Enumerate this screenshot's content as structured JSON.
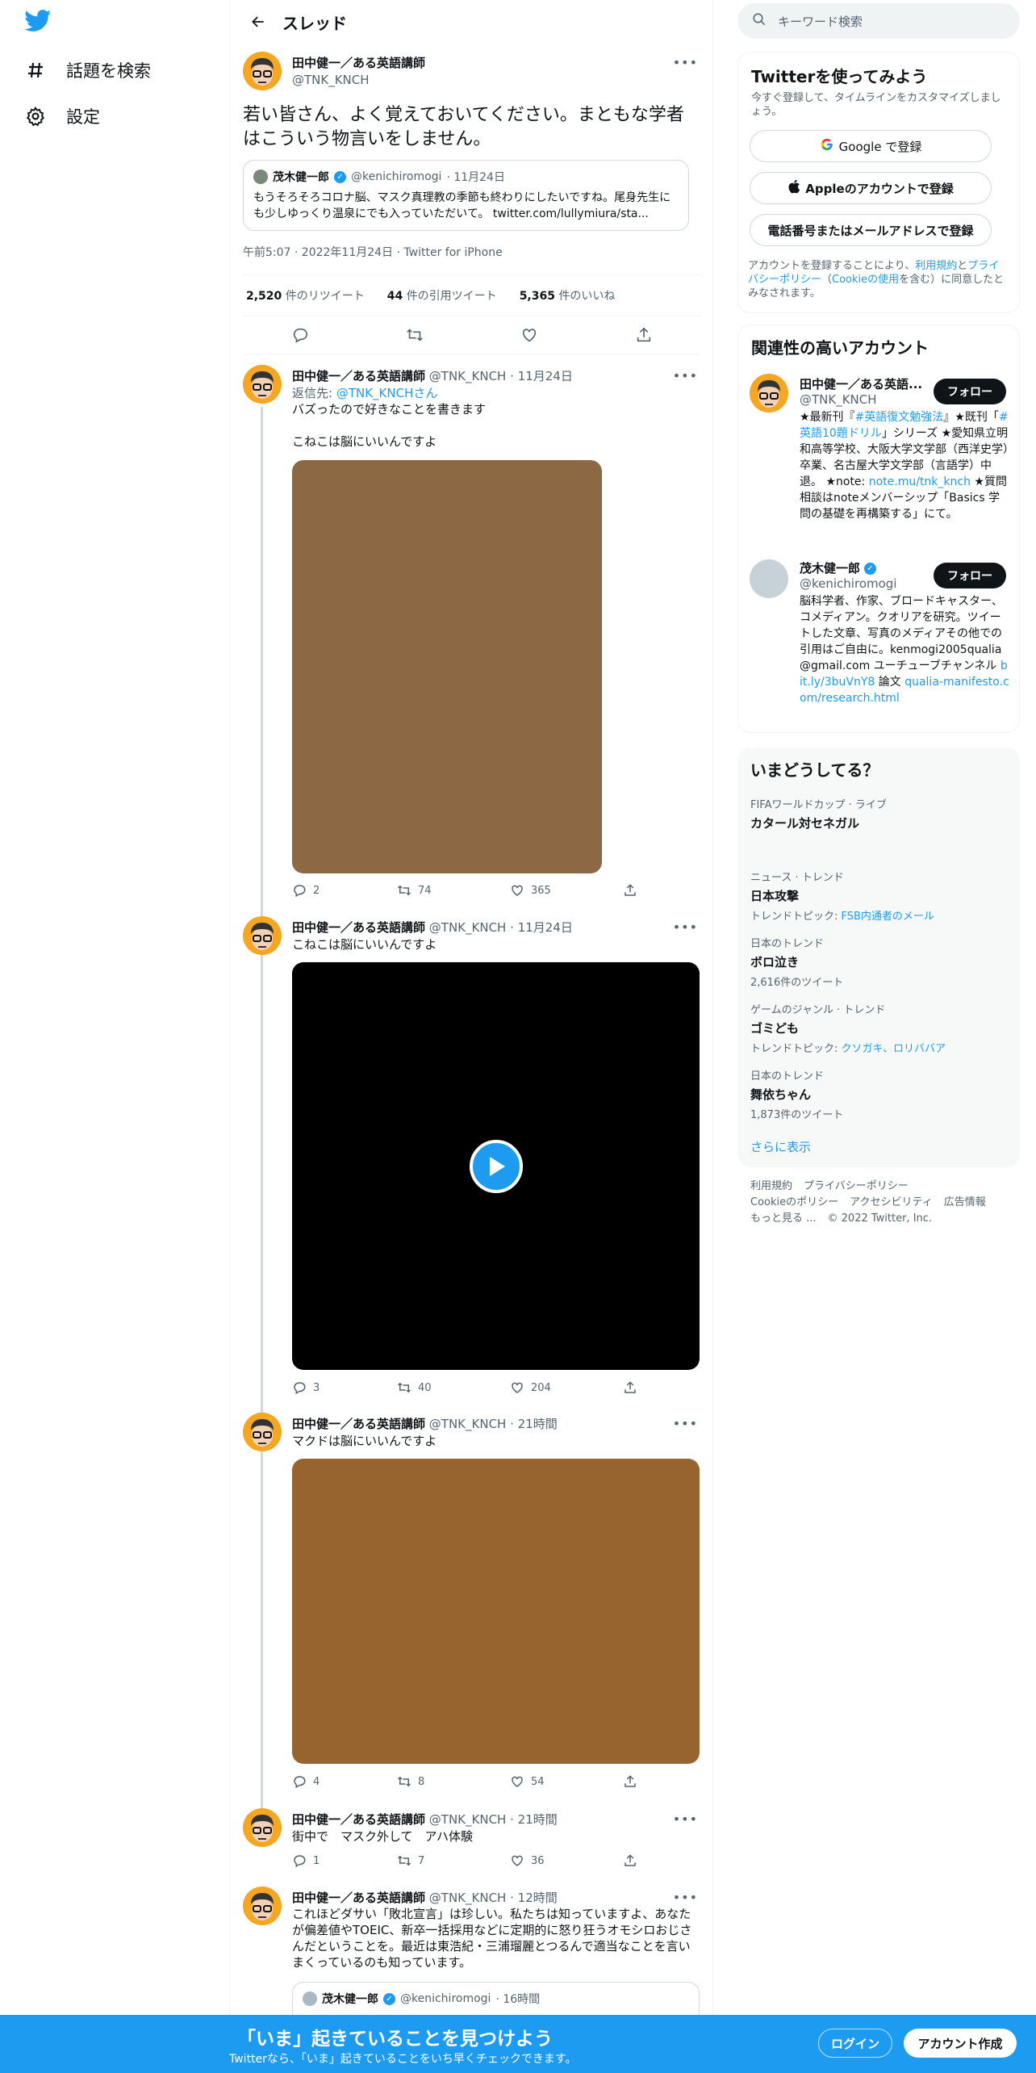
{
  "nav": {
    "explore": "話題を検索",
    "settings": "設定"
  },
  "header": {
    "title": "スレッド"
  },
  "main_tweet": {
    "name": "田中健一／ある英語講師",
    "handle": "@TNK_KNCH",
    "text": "若い皆さん、よく覚えておいてください。まともな学者はこういう物言いをしません。",
    "quote": {
      "name": "茂木健一郎",
      "handle": "@kenichiromogi",
      "date": "· 11月24日",
      "text": "もうそろそろコロナ脳、マスク真理教の季節も終わりにしたいですね。尾身先生にも少しゆっくり温泉にでも入っていただいて。 twitter.com/lullymiura/sta..."
    },
    "meta": "午前5:07 · 2022年11月24日 · Twitter for iPhone",
    "retweets": "2,520",
    "retweets_label": "件のリツイート",
    "quotes": "44",
    "quotes_label": "件の引用ツイート",
    "likes": "5,365",
    "likes_label": "件のいいね"
  },
  "replies": [
    {
      "name": "田中健一／ある英語講師",
      "handle": "@TNK_KNCH",
      "date": "· 11月24日",
      "reply_to_prefix": "返信先: ",
      "reply_to": "@TNK_KNCHさん",
      "line1": "バズったので好きなことを書きます",
      "line2": "こねこは脳にいいんですよ",
      "replies": "2",
      "retweets": "74",
      "likes": "365"
    },
    {
      "name": "田中健一／ある英語講師",
      "handle": "@TNK_KNCH",
      "date": "· 11月24日",
      "text": "こねこは脳にいいんですよ",
      "replies": "3",
      "retweets": "40",
      "likes": "204"
    },
    {
      "name": "田中健一／ある英語講師",
      "handle": "@TNK_KNCH",
      "date": "· 21時間",
      "text": "マクドは脳にいいんですよ",
      "replies": "4",
      "retweets": "8",
      "likes": "54"
    },
    {
      "name": "田中健一／ある英語講師",
      "handle": "@TNK_KNCH",
      "date": "· 21時間",
      "text": "街中で　マスク外して　アハ体験",
      "replies": "1",
      "retweets": "7",
      "likes": "36"
    },
    {
      "name": "田中健一／ある英語講師",
      "handle": "@TNK_KNCH",
      "date": "· 12時間",
      "text": "これほどダサい「敗北宣言」は珍しい。私たちは知っていますよ、あなたが偏差値やTOEIC、新卒一括採用などに定期的に怒り狂うオモシロおじさんだということを。最近は東浩紀・三浦瑠麗とつるんで適当なことを言いまくっているのも知っています。",
      "quote_name": "茂木健一郎",
      "quote_handle": "@kenichiromogi",
      "quote_date": "· 16時間"
    }
  ],
  "right": {
    "search_placeholder": "キーワード検索",
    "signup": {
      "title": "Twitterを使ってみよう",
      "subtitle": "今すぐ登録して、タイムラインをカスタマイズしましょう。",
      "google": "Google で登録",
      "apple": "Appleのアカウントで登録",
      "phone": "電話番号またはメールアドレスで登録",
      "terms_a": "アカウントを登録することにより、",
      "terms_link1": "利用規約",
      "terms_b": "と",
      "terms_link2": "プライバシーポリシー",
      "terms_c": "（",
      "terms_link3": "Cookieの使用",
      "terms_d": "を含む）に同意したとみなされます。"
    },
    "related": {
      "title": "関連性の高いアカウント",
      "follow": "フォロー",
      "accounts": [
        {
          "name": "田中健一／ある英語...",
          "handle": "@TNK_KNCH",
          "bio_a": "★最新刊『",
          "bio_l1": "#英語復文勉強法",
          "bio_b": "』★既刊「",
          "bio_l2": "#英語10題ドリル",
          "bio_c": "」シリーズ ★愛知県立明和高等学校、大阪大学文学部（西洋史学）卒業、名古屋大学文学部（言語学）中退。 ★note: ",
          "bio_l3": "note.mu/tnk_knch",
          "bio_d": " ★質問相談はnoteメンバーシップ「Basics 学問の基礎を再構築する」にて。"
        },
        {
          "name": "茂木健一郎",
          "handle": "@kenichiromogi",
          "bio_a": "脳科学者、作家、ブロードキャスター、コメディアン。クオリアを研究。ツイートした文章、写真のメディアその他での引用はご自由に。kenmogi2005qualia@gmail.com ユーチューブチャンネル ",
          "bio_l1": "bit.ly/3buVnY8",
          "bio_b": " 論文 ",
          "bio_l2": "qualia-manifesto.com/research.html"
        }
      ]
    },
    "trends": {
      "title": "いまどうしてる？",
      "items": [
        {
          "cat": "FIFAワールドカップ · ライブ",
          "title": "カタール対セネガル",
          "extra": ""
        },
        {
          "cat": "ニュース · トレンド",
          "title": "日本攻撃",
          "extra_prefix": "トレンドトピック: ",
          "extra": "FSB内通者のメール"
        },
        {
          "cat": "日本のトレンド",
          "title": "ボロ泣き",
          "count": "2,616件のツイート"
        },
        {
          "cat": "ゲームのジャンル · トレンド",
          "title": "ゴミども",
          "extra_prefix": "トレンドトピック: ",
          "extra": "クソガキ、ロリババア"
        },
        {
          "cat": "日本のトレンド",
          "title": "舞依ちゃん",
          "count": "1,873件のツイート"
        }
      ],
      "more": "さらに表示"
    },
    "footer": {
      "l1": "利用規約",
      "l2": "プライバシーポリシー",
      "l3": "Cookieのポリシー",
      "l4": "アクセシビリティ",
      "l5": "広告情報",
      "l6": "もっと見る ...",
      "copy": "© 2022 Twitter, Inc."
    }
  },
  "bottom": {
    "title": "「いま」起きていることを見つけよう",
    "subtitle": "Twitterなら、「いま」起きていることをいち早くチェックできます。",
    "login": "ログイン",
    "signup": "アカウント作成"
  },
  "colors": {
    "accent": "#1d9bf0",
    "text": "#0f1419",
    "muted": "#536471",
    "media1": "#8d6844",
    "media3": "#976430"
  }
}
